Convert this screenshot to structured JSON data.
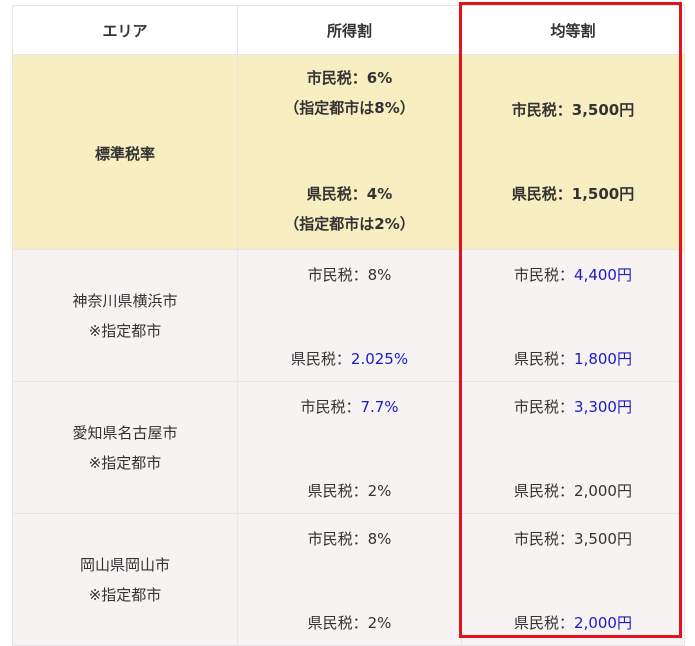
{
  "header": {
    "area": "エリア",
    "income": "所得割",
    "per_capita": "均等割"
  },
  "standard": {
    "label": "標準税率",
    "income_city": "市民税：6%",
    "income_city_note": "（指定都市は8%）",
    "income_pref": "県民税：4%",
    "income_pref_note": "（指定都市は2%）",
    "per_capita_city": "市民税：3,500円",
    "per_capita_pref": "県民税：1,500円"
  },
  "rows": [
    {
      "city": "神奈川県横浜市",
      "note": "※指定都市",
      "income_city_label": "市民税：",
      "income_city_value": "8%",
      "income_pref_label": "県民税：",
      "income_pref_value": "2.025%",
      "pc_city_label": "市民税：",
      "pc_city_value": "4,400円",
      "pc_pref_label": "県民税：",
      "pc_pref_value": "1,800円"
    },
    {
      "city": "愛知県名古屋市",
      "note": "※指定都市",
      "income_city_label": "市民税：",
      "income_city_value": "7.7%",
      "income_pref_label": "県民税：",
      "income_pref_value": "2%",
      "pc_city_label": "市民税：",
      "pc_city_value": "3,300円",
      "pc_pref_label": "県民税：",
      "pc_pref_value": "2,000円"
    },
    {
      "city": "岡山県岡山市",
      "note": "※指定都市",
      "income_city_label": "市民税：",
      "income_city_value": "8%",
      "income_pref_label": "県民税：",
      "income_pref_value": "2%",
      "pc_city_label": "市民税：",
      "pc_city_value": "3,500円",
      "pc_pref_label": "県民税：",
      "pc_pref_value": "2,000円"
    }
  ],
  "colors": {
    "highlight_border": "#e0141e",
    "standard_bg": "#f8eec2",
    "row_bg": "#f7f3f2",
    "changed_value": "#1a1acc"
  }
}
